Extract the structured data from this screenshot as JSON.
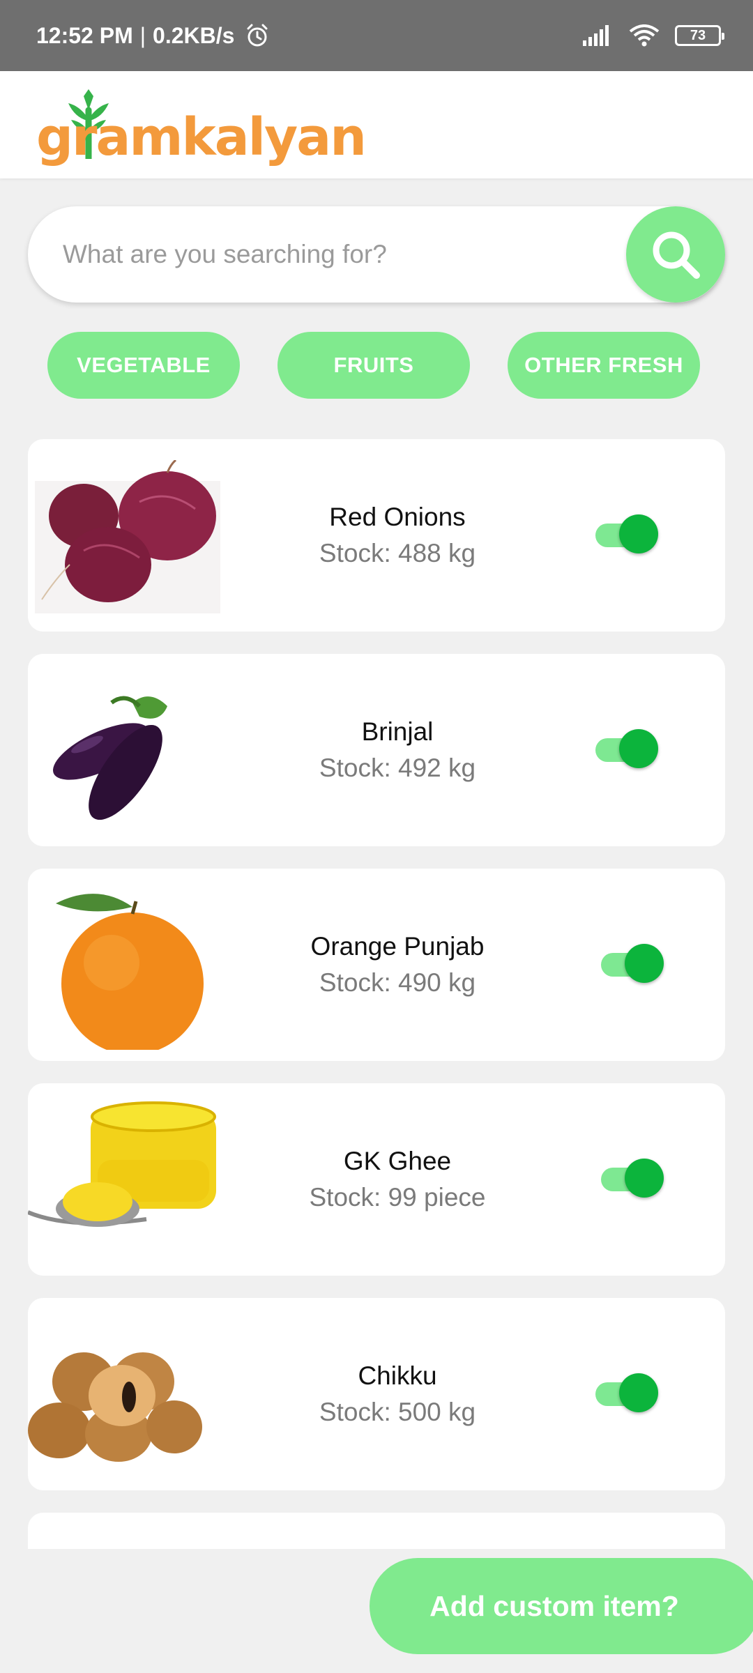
{
  "status_bar": {
    "time": "12:52 PM",
    "separator": "|",
    "speed": "0.2KB/s",
    "battery": "73"
  },
  "header": {
    "logo_text": "gramkalyan",
    "brand_color": "#f39a3c"
  },
  "search": {
    "placeholder": "What are you searching for?"
  },
  "categories": [
    {
      "label": "VEGETABLE"
    },
    {
      "label": "FRUITS"
    },
    {
      "label": "OTHER FRESH"
    }
  ],
  "products": [
    {
      "name": "Red Onions",
      "stock": "Stock: 488 kg",
      "enabled": true
    },
    {
      "name": "Brinjal",
      "stock": "Stock: 492 kg",
      "enabled": true
    },
    {
      "name": "Orange Punjab",
      "stock": "Stock: 490 kg",
      "enabled": true
    },
    {
      "name": "GK Ghee",
      "stock": "Stock: 99 piece",
      "enabled": true
    },
    {
      "name": "Chikku",
      "stock": "Stock: 500 kg",
      "enabled": true
    }
  ],
  "add_custom": {
    "label": "Add custom item?"
  },
  "colors": {
    "accent": "#80ea8e",
    "toggle_on": "#0cb43c",
    "status_bar": "#6f6f6f"
  }
}
